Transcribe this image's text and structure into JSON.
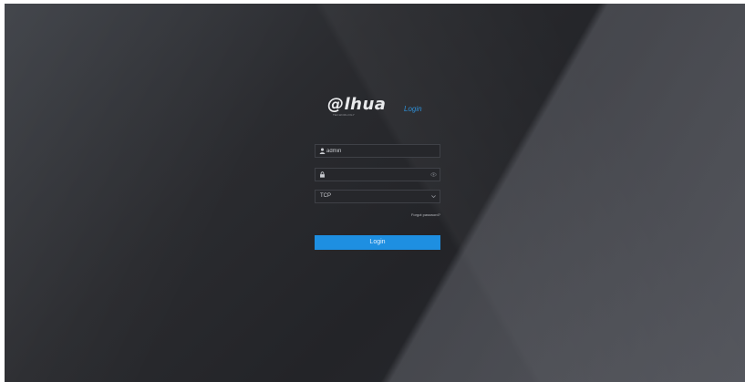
{
  "brand": {
    "logo_text": "@lhua",
    "logo_subtext": "TECHNOLOGY",
    "page_label": "Login"
  },
  "form": {
    "username_value": "admin",
    "password_value": "",
    "network_value": "TCP",
    "forgot_link": "Forgot password?",
    "login_label": "Login"
  },
  "colors": {
    "accent": "#1e8fe1",
    "background": "#2a2b2f",
    "field_bg": "#26272b"
  }
}
